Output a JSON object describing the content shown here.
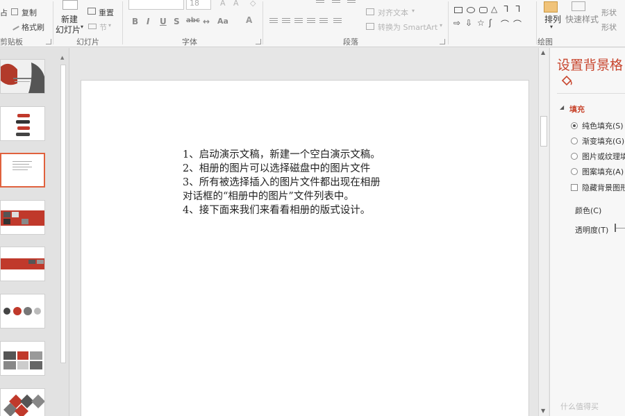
{
  "ribbon": {
    "clipboard": {
      "copy": "复制",
      "format_painter": "格式刷",
      "group": "剪贴板",
      "paste_fragment": "占"
    },
    "slides": {
      "new_slide_line1": "新建",
      "new_slide_line2": "幻灯片",
      "reset": "重置",
      "section": "节",
      "group": "幻灯片"
    },
    "font": {
      "font_size": "18",
      "bold": "B",
      "italic": "I",
      "underline": "U",
      "strike": "S",
      "spacing": "abc",
      "aa": "Aa",
      "group": "字体"
    },
    "paragraph": {
      "align_text": "对齐文本",
      "convert_smartart": "转换为 SmartArt",
      "group": "段落"
    },
    "drawing": {
      "arrange": "排列",
      "quick_styles": "快速样式",
      "shape_fill": "形状",
      "shape_outline": "形状",
      "group": "绘图"
    }
  },
  "thumbnails": [
    {
      "index": 1,
      "selected": false,
      "style": "title-hero"
    },
    {
      "index": 2,
      "selected": false,
      "style": "red-bars"
    },
    {
      "index": 3,
      "selected": true,
      "style": "text"
    },
    {
      "index": 4,
      "selected": false,
      "style": "photo-row"
    },
    {
      "index": 5,
      "selected": false,
      "style": "red-band"
    },
    {
      "index": 6,
      "selected": false,
      "style": "circles"
    },
    {
      "index": 7,
      "selected": false,
      "style": "grid"
    },
    {
      "index": 8,
      "selected": false,
      "style": "diamonds"
    }
  ],
  "slide": {
    "paragraphs": [
      "1、启动演示文稿，新建一个空白演示文稿。",
      "2、相册的图片可以选择磁盘中的图片文件",
      "3、所有被选择插入的图片文件都出现在相册对话框的“相册中的图片”文件列表中。",
      "4、接下面来我们来看看相册的版式设计。"
    ]
  },
  "format_pane": {
    "title": "设置背景格",
    "section": "填充",
    "options": [
      {
        "label": "纯色填充(S)",
        "selected": true
      },
      {
        "label": "渐变填充(G)",
        "selected": false
      },
      {
        "label": "图片或纹理填",
        "selected": false
      },
      {
        "label": "图案填充(A)",
        "selected": false
      }
    ],
    "hide_bg": "隐藏背景图形",
    "color_label": "颜色(C)",
    "transparency_label": "透明度(T)"
  },
  "watermark": "什么值得买",
  "colors": {
    "accent": "#c8462e",
    "selected_thumb": "#e0613d"
  }
}
